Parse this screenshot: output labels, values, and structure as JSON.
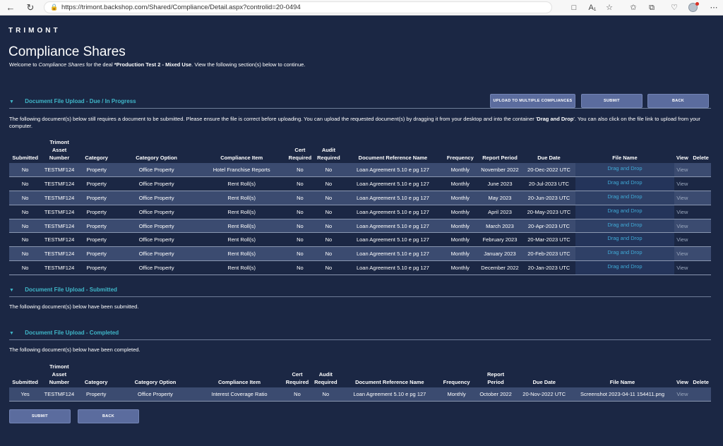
{
  "browser": {
    "url": "https://trimont.backshop.com/Shared/Compliance/Detail.aspx?controlid=20-0494"
  },
  "logo": "TRIMONT",
  "page": {
    "title": "Compliance Shares",
    "welcome_prefix": "Welcome to ",
    "welcome_app": "Compliance Shares",
    "welcome_mid": " for the deal ",
    "welcome_deal": "*Production Test 2 - Mixed Use",
    "welcome_suffix": ". View the following section(s) below to continue."
  },
  "buttons": {
    "upload_multiple": "UPLOAD TO MULTIPLE COMPLIANCES",
    "submit": "SUBMIT",
    "back": "BACK"
  },
  "sections": {
    "due": {
      "title": "Document File Upload - Due / In Progress",
      "desc_1": "The following document(s) below still requires a document to be submitted. Please ensure the file is correct before uploading. You can upload the requested document(s) by dragging it from your desktop and into the container '",
      "desc_bold": "Drag and Drop",
      "desc_2": "'. You can also click on the file link to upload from your computer."
    },
    "submitted": {
      "title": "Document File Upload - Submitted",
      "desc": "The following document(s) below have been submitted."
    },
    "completed": {
      "title": "Document File Upload - Completed",
      "desc": "The following document(s) below have been completed."
    }
  },
  "columns": {
    "submitted": "Submitted",
    "asset_1": "Trimont",
    "asset_2": "Asset",
    "asset_3": "Number",
    "category": "Category",
    "category_option": "Category Option",
    "compliance_item": "Compliance Item",
    "cert_1": "Cert",
    "cert_2": "Required",
    "audit_1": "Audit",
    "audit_2": "Required",
    "doc_ref": "Document Reference Name",
    "frequency": "Frequency",
    "report_period": "Report Period",
    "report_1": "Report",
    "report_2": "Period",
    "due_date": "Due Date",
    "file_name": "File Name",
    "view": "View",
    "delete": "Delete"
  },
  "due_rows": [
    {
      "submitted": "No",
      "asset": "TESTMF124",
      "category": "Property",
      "option": "Office Property",
      "item": "Hotel Franchise Reports",
      "cert": "No",
      "audit": "No",
      "docref": "Loan Agreement 5.10 e pg 127",
      "freq": "Monthly",
      "period": "November 2022",
      "due": "20-Dec-2022 UTC",
      "file": "Drag and Drop",
      "view": "View"
    },
    {
      "submitted": "No",
      "asset": "TESTMF124",
      "category": "Property",
      "option": "Office Property",
      "item": "Rent Roll(s)",
      "cert": "No",
      "audit": "No",
      "docref": "Loan Agreement 5.10 e pg 127",
      "freq": "Monthly",
      "period": "June 2023",
      "due": "20-Jul-2023 UTC",
      "file": "Drag and Drop",
      "view": "View"
    },
    {
      "submitted": "No",
      "asset": "TESTMF124",
      "category": "Property",
      "option": "Office Property",
      "item": "Rent Roll(s)",
      "cert": "No",
      "audit": "No",
      "docref": "Loan Agreement 5.10 e pg 127",
      "freq": "Monthly",
      "period": "May 2023",
      "due": "20-Jun-2023 UTC",
      "file": "Drag and Drop",
      "view": "View"
    },
    {
      "submitted": "No",
      "asset": "TESTMF124",
      "category": "Property",
      "option": "Office Property",
      "item": "Rent Roll(s)",
      "cert": "No",
      "audit": "No",
      "docref": "Loan Agreement 5.10 e pg 127",
      "freq": "Monthly",
      "period": "April 2023",
      "due": "20-May-2023 UTC",
      "file": "Drag and Drop",
      "view": "View"
    },
    {
      "submitted": "No",
      "asset": "TESTMF124",
      "category": "Property",
      "option": "Office Property",
      "item": "Rent Roll(s)",
      "cert": "No",
      "audit": "No",
      "docref": "Loan Agreement 5.10 e pg 127",
      "freq": "Monthly",
      "period": "March 2023",
      "due": "20-Apr-2023 UTC",
      "file": "Drag and Drop",
      "view": "View"
    },
    {
      "submitted": "No",
      "asset": "TESTMF124",
      "category": "Property",
      "option": "Office Property",
      "item": "Rent Roll(s)",
      "cert": "No",
      "audit": "No",
      "docref": "Loan Agreement 5.10 e pg 127",
      "freq": "Monthly",
      "period": "February 2023",
      "due": "20-Mar-2023 UTC",
      "file": "Drag and Drop",
      "view": "View"
    },
    {
      "submitted": "No",
      "asset": "TESTMF124",
      "category": "Property",
      "option": "Office Property",
      "item": "Rent Roll(s)",
      "cert": "No",
      "audit": "No",
      "docref": "Loan Agreement 5.10 e pg 127",
      "freq": "Monthly",
      "period": "January 2023",
      "due": "20-Feb-2023 UTC",
      "file": "Drag and Drop",
      "view": "View"
    },
    {
      "submitted": "No",
      "asset": "TESTMF124",
      "category": "Property",
      "option": "Office Property",
      "item": "Rent Roll(s)",
      "cert": "No",
      "audit": "No",
      "docref": "Loan Agreement 5.10 e pg 127",
      "freq": "Monthly",
      "period": "December 2022",
      "due": "20-Jan-2023 UTC",
      "file": "Drag and Drop",
      "view": "View"
    }
  ],
  "completed_rows": [
    {
      "submitted": "Yes",
      "asset": "TESTMF124",
      "category": "Property",
      "option": "Office Property",
      "item": "Interest Coverage Ratio",
      "cert": "No",
      "audit": "No",
      "docref": "Loan Agreement 5.10 e pg 127",
      "freq": "Monthly",
      "period": "October 2022",
      "due": "20-Nov-2022 UTC",
      "file": "Screenshot 2023-04-11 154411.png",
      "view": "View"
    }
  ],
  "colors": {
    "background": "#1b2744",
    "accent": "#3fb6c8",
    "button": "#5b6c9e",
    "row_alt": "#3b4b70",
    "link": "#3fa9d6"
  }
}
